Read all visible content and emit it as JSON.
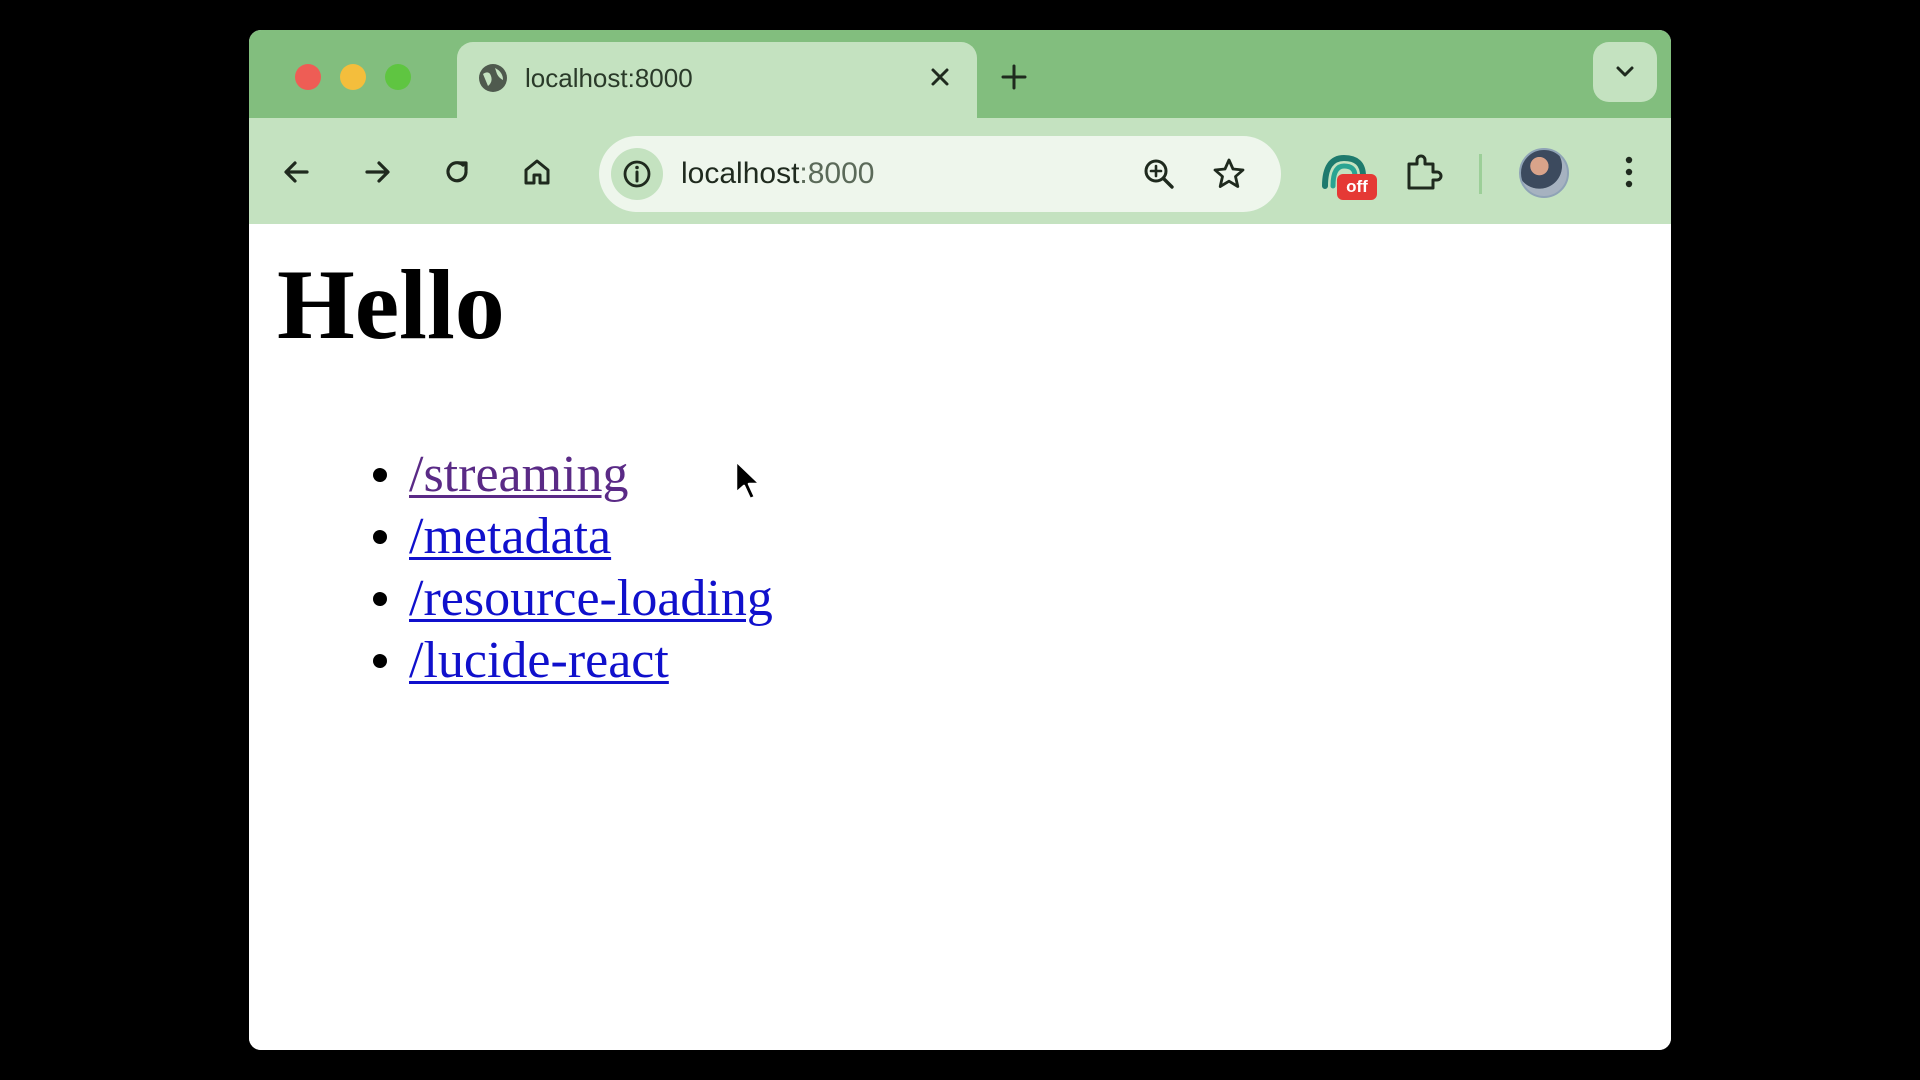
{
  "tab": {
    "title": "localhost:8000"
  },
  "omnibox": {
    "host": "localhost",
    "port": ":8000"
  },
  "extension": {
    "badge": "off"
  },
  "page": {
    "heading": "Hello",
    "links": [
      {
        "label": "/streaming",
        "state": "visited"
      },
      {
        "label": "/metadata",
        "state": "link"
      },
      {
        "label": "/resource-loading",
        "state": "link"
      },
      {
        "label": "/lucide-react",
        "state": "link"
      }
    ]
  },
  "colors": {
    "tabstrip": "#82be7e",
    "toolbar": "#c4e2c0",
    "link": "#1010cc",
    "visited_link": "#5a2a86",
    "badge": "#e53935"
  }
}
